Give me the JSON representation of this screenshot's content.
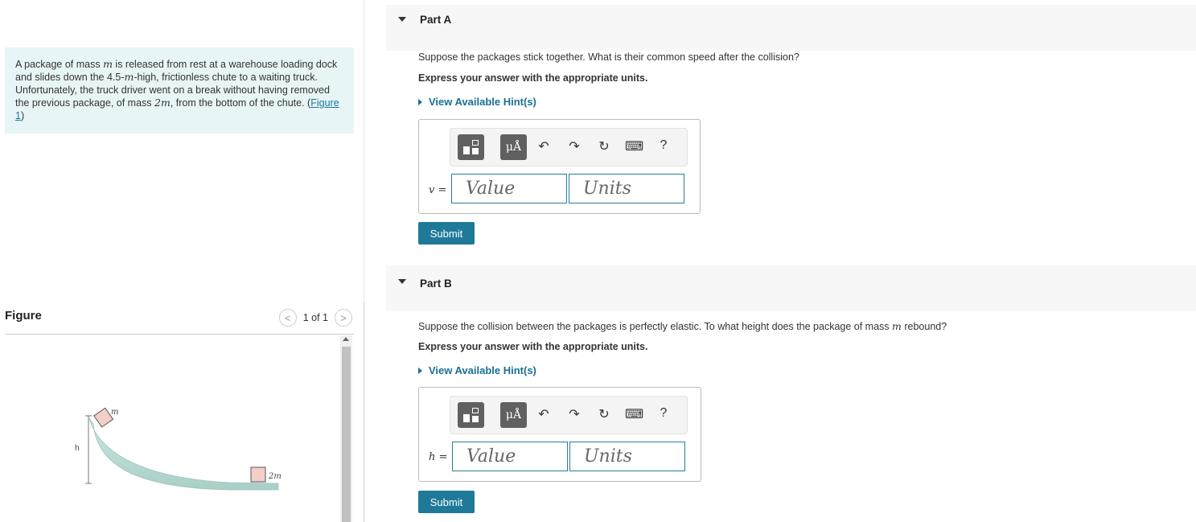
{
  "problem": {
    "text_1": "A package of mass ",
    "mass_symbol": "m",
    "text_2": " is released from rest at a warehouse loading dock and slides down the 4.5-",
    "unit_m": "m",
    "text_3": "-high, frictionless chute to a waiting truck. Unfortunately, the truck driver went on a break without having removed the previous package, of mass ",
    "mass2_symbol": "2m",
    "text_4": ", from the bottom of the chute. (",
    "figure_link": "Figure 1",
    "text_5": ")"
  },
  "figure": {
    "title": "Figure",
    "pager": "1 of 1",
    "prev_glyph": "<",
    "next_glyph": ">",
    "label_m": "m",
    "label_h": "h",
    "label_2m": "2m",
    "colors": {
      "chute": "#a9cfc8",
      "box": "#f3cfc8"
    }
  },
  "toolbar": {
    "mu_label": "μÅ",
    "undo_glyph": "↶",
    "redo_glyph": "↷",
    "reset_glyph": "↻",
    "keyboard_glyph": "⌨",
    "help_label": "?"
  },
  "part_a": {
    "label": "Part A",
    "question": "Suppose the packages stick together. What is their common speed after the collision?",
    "instruction": "Express your answer with the appropriate units.",
    "hint": "View Available Hint(s)",
    "var_symbol": "v",
    "equals": " =",
    "value_placeholder": "Value",
    "units_placeholder": "Units",
    "submit": "Submit"
  },
  "part_b": {
    "label": "Part B",
    "question_1": "Suppose the collision between the packages is perfectly elastic. To what height does the package of mass ",
    "mass_symbol": "m",
    "question_2": " rebound?",
    "instruction": "Express your answer with the appropriate units.",
    "hint": "View Available Hint(s)",
    "var_symbol": "h",
    "equals": " =",
    "value_placeholder": "Value",
    "units_placeholder": "Units",
    "submit": "Submit"
  }
}
